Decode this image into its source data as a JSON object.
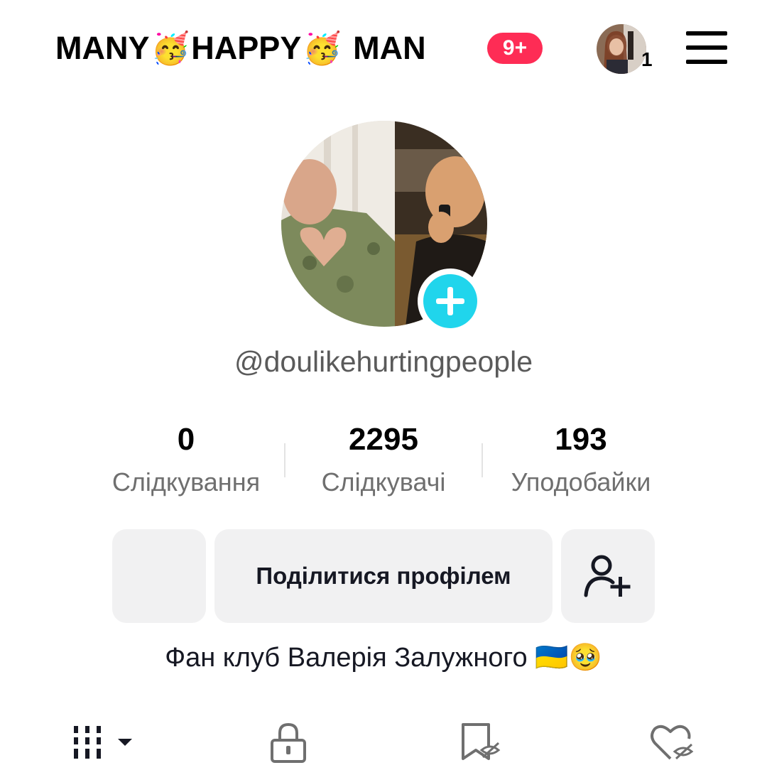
{
  "header": {
    "title_words": [
      "MANY",
      "HAPPY",
      "MAN"
    ],
    "title_emoji": "🥳",
    "notification_badge": "9+",
    "account_count": "1"
  },
  "profile": {
    "handle": "@doulikehurtingpeople",
    "bio": "Фан клуб Валерія Залужного 🇺🇦🥹"
  },
  "stats": [
    {
      "value": "0",
      "label": "Слідкування"
    },
    {
      "value": "2295",
      "label": "Слідкувачі"
    },
    {
      "value": "193",
      "label": "Уподобайки"
    }
  ],
  "actions": {
    "share_label": "Поділитися профілем"
  },
  "tabs": [
    "videos-grid-icon",
    "lock-icon",
    "bookmark-hidden-icon",
    "heart-hidden-icon"
  ],
  "colors": {
    "badge": "#fe2c55",
    "add_button": "#20d5ec",
    "button_bg": "#f1f1f2"
  }
}
